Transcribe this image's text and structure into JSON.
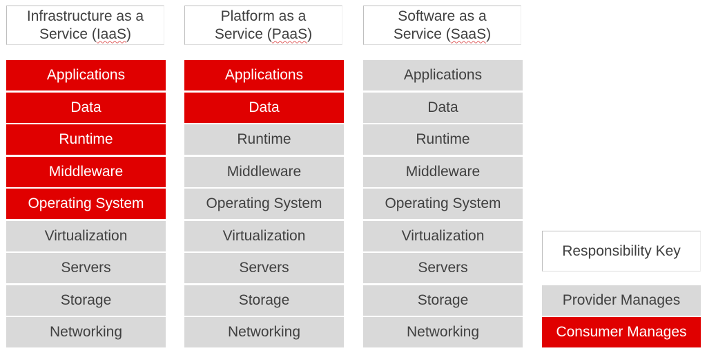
{
  "colors": {
    "consumer": "#e00000",
    "provider": "#d9d9d9",
    "text": "#404040"
  },
  "columns": [
    {
      "title_line1": "Infrastructure as a",
      "title_line2_pre": "Service (",
      "title_abbr": "IaaS",
      "title_line2_post": ")",
      "consumer_rows": 5
    },
    {
      "title_line1": "Platform as a",
      "title_line2_pre": "Service (",
      "title_abbr": "PaaS",
      "title_line2_post": ")",
      "consumer_rows": 2
    },
    {
      "title_line1": "Software as a",
      "title_line2_pre": "Service (",
      "title_abbr": "SaaS",
      "title_line2_post": ")",
      "consumer_rows": 0
    }
  ],
  "layers": [
    "Applications",
    "Data",
    "Runtime",
    "Middleware",
    "Operating System",
    "Virtualization",
    "Servers",
    "Storage",
    "Networking"
  ],
  "key": {
    "title": "Responsibility Key",
    "provider": "Provider Manages",
    "consumer": "Consumer Manages"
  }
}
